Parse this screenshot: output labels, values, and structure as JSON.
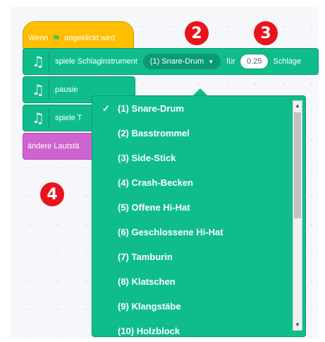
{
  "blocks": {
    "hat_text_1": "Wenn",
    "hat_text_2": "angeklickt wird",
    "play_drum_prefix": "spiele Schlaginstrument",
    "selected_instrument": "(1) Snare-Drum",
    "for_label": "für",
    "beats_value": "0.25",
    "beats_label": "Schläge",
    "pause_label": "pausie",
    "play_note_label": "spiele T",
    "volume_label": "ändere Lautstä"
  },
  "markers": [
    "2",
    "3",
    "4"
  ],
  "dropdown": {
    "check": "✓",
    "options": [
      "(1) Snare-Drum",
      "(2) Basstrommel",
      "(3) Side-Stick",
      "(4) Crash-Becken",
      "(5) Offene Hi-Hat",
      "(6) Geschlossene Hi-Hat",
      "(7) Tamburin",
      "(8) Klatschen",
      "(9) Klangstäbe",
      "(10) Holzblock"
    ]
  },
  "icons": {
    "flag": "green-flag-icon",
    "music": "music-notes-icon",
    "dropdown_arrow": "caret-down-icon"
  },
  "colors": {
    "event_yellow": "#ffbf00",
    "music_green": "#0fbd8c",
    "looks_purple": "#cf63cf",
    "marker_red": "#e8141b"
  }
}
